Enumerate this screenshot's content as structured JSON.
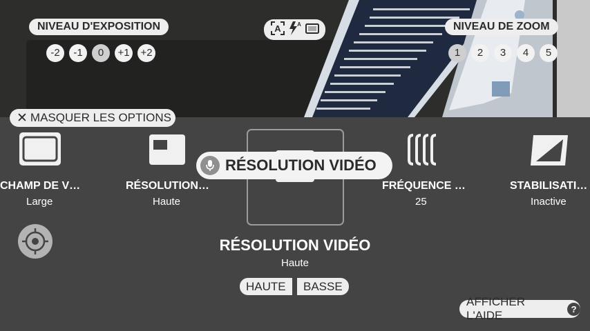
{
  "exposure": {
    "label": "NIVEAU D'EXPOSITION",
    "levels": [
      "-2",
      "-1",
      "0",
      "+1",
      "+2"
    ],
    "selected": "0"
  },
  "mode_icons": [
    "auto-scene-icon",
    "flash-auto-icon",
    "aspect-ratio-icon"
  ],
  "zoom": {
    "label": "NIVEAU DE ZOOM",
    "levels": [
      "1",
      "2",
      "3",
      "4",
      "5"
    ],
    "selected": "1"
  },
  "hide_options": {
    "label": "MASQUER LES OPTIONS",
    "icon": "close-icon"
  },
  "options": [
    {
      "title": "CHAMP DE V…",
      "value": "Large",
      "icon": "field-of-view-icon"
    },
    {
      "title": "RÉSOLUTION…",
      "value": "Haute",
      "icon": "photo-resolution-icon"
    },
    {
      "title": "RÉSOLUTION VIDÉO",
      "value": "Haute",
      "icon": "video-resolution-icon"
    },
    {
      "title": "FRÉQUENCE …",
      "value": "25",
      "icon": "frame-rate-icon"
    },
    {
      "title": "STABILISATI…",
      "value": "Inactive",
      "icon": "stabilization-icon"
    }
  ],
  "voice_bubble": {
    "text": "RÉSOLUTION VIDÉO",
    "icon": "microphone-icon"
  },
  "selected_option": {
    "title": "RÉSOLUTION VIDÉO",
    "value": "Haute",
    "choices": [
      "HAUTE",
      "BASSE"
    ]
  },
  "help": {
    "label": "AFFICHER L'AIDE",
    "icon_glyph": "?"
  },
  "colors": {
    "panel_bg": "#444444",
    "pill_bg": "#eeeeee",
    "text_dark": "#2b2b2b"
  }
}
